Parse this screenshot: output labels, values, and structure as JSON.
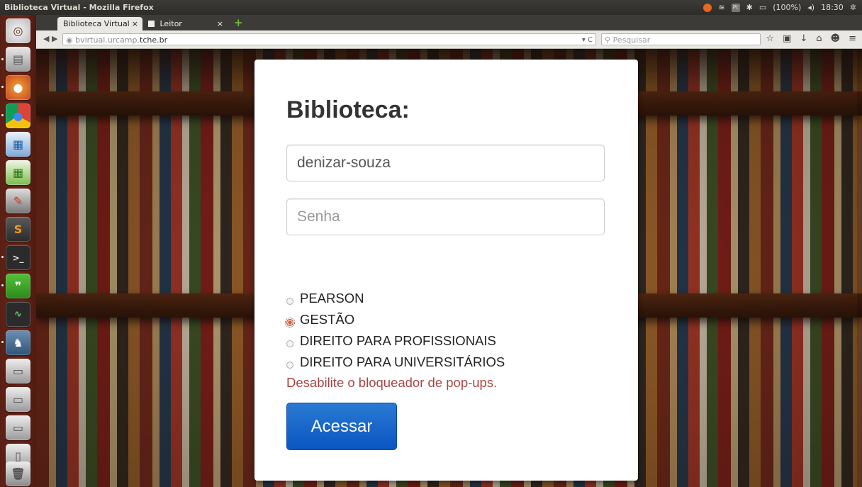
{
  "window": {
    "title": "Biblioteca Virtual - Mozilla Firefox"
  },
  "tray": {
    "battery": "(100%)",
    "clock": "18:30"
  },
  "tabs": [
    {
      "label": "Biblioteca Virtual"
    },
    {
      "label": "Leitor"
    }
  ],
  "navbar": {
    "url_prefix": "bvirtual.urcamp.",
    "url_domain": "tche.br",
    "search_placeholder": "Pesquisar"
  },
  "login": {
    "title": "Biblioteca:",
    "username_value": "denizar-souza",
    "password_placeholder": "Senha",
    "options": [
      {
        "label": "PEARSON",
        "checked": false
      },
      {
        "label": "GESTÃO",
        "checked": true
      },
      {
        "label": "DIREITO PARA PROFISSIONAIS",
        "checked": false
      },
      {
        "label": "DIREITO PARA UNIVERSITÁRIOS",
        "checked": false
      }
    ],
    "warning": "Desabilite o bloqueador de pop-ups.",
    "submit_label": "Acessar"
  },
  "colors": {
    "accent_button": "#0a55c2",
    "warning_text": "#a94442",
    "launcher": "#6e2619"
  }
}
